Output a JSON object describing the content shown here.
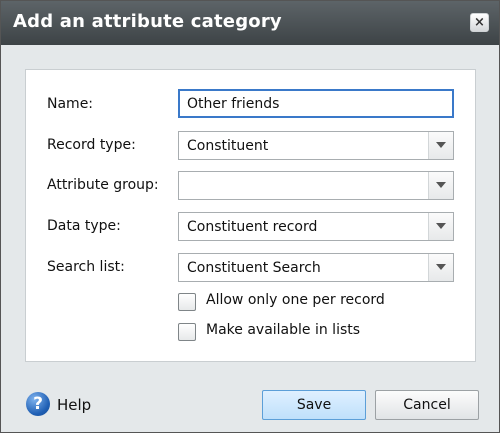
{
  "dialog": {
    "title": "Add an attribute category",
    "close_icon": "×"
  },
  "form": {
    "name": {
      "label": "Name:",
      "value": "Other friends"
    },
    "record_type": {
      "label": "Record type:",
      "value": "Constituent"
    },
    "attribute_group": {
      "label": "Attribute group:",
      "value": ""
    },
    "data_type": {
      "label": "Data type:",
      "value": "Constituent record"
    },
    "search_list": {
      "label": "Search list:",
      "value": "Constituent Search"
    },
    "allow_only_one": {
      "label": "Allow only one per record",
      "checked": false
    },
    "make_available": {
      "label": "Make available in lists",
      "checked": false
    }
  },
  "footer": {
    "help_label": "Help",
    "help_icon": "?",
    "save_label": "Save",
    "cancel_label": "Cancel"
  },
  "colors": {
    "title_bar": "#4d5458",
    "active_border": "#3a79c9",
    "primary_button": "#c7e4fc"
  },
  "icons": [
    "close-icon",
    "dropdown-arrow-icon",
    "help-icon"
  ]
}
